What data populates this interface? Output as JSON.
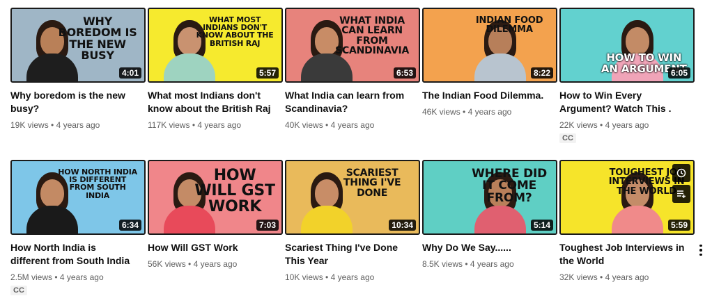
{
  "videos": [
    {
      "title": "Why boredom is the new busy?",
      "views": "19K views",
      "age": "4 years ago",
      "duration": "4:01",
      "thumb_text": "WHY BOREDOM IS THE NEW BUSY",
      "bg": "#9fb6c6",
      "cc": ""
    },
    {
      "title": "What most Indians don't know about the British Raj",
      "views": "117K views",
      "age": "4 years ago",
      "duration": "5:57",
      "thumb_text": "WHAT MOST INDIANS DON'T KNOW ABOUT THE BRITISH RAJ",
      "bg": "#f6ea2e",
      "cc": ""
    },
    {
      "title": "What India can learn from Scandinavia?",
      "views": "40K views",
      "age": "4 years ago",
      "duration": "6:53",
      "thumb_text": "WHAT INDIA CAN LEARN FROM SCANDINAVIA",
      "bg": "#e7837c",
      "cc": ""
    },
    {
      "title": "The Indian Food Dilemma.",
      "views": "46K views",
      "age": "4 years ago",
      "duration": "8:22",
      "thumb_text": "INDIAN FOOD DILEMMA",
      "bg": "#f3a24e",
      "cc": ""
    },
    {
      "title": "How to Win Every Argument? Watch This .",
      "views": "22K views",
      "age": "4 years ago",
      "duration": "6:05",
      "thumb_text": "HOW TO WIN AN ARGUMENT",
      "bg": "#62d1cf",
      "cc": "CC"
    },
    {
      "title": "How North India is different from South India",
      "views": "2.5M views",
      "age": "4 years ago",
      "duration": "6:34",
      "thumb_text": "HOW NORTH INDIA IS DIFFERENT FROM SOUTH INDIA",
      "bg": "#7ec6e8",
      "cc": "CC"
    },
    {
      "title": "How Will GST Work",
      "views": "56K views",
      "age": "4 years ago",
      "duration": "7:03",
      "thumb_text": "HOW WILL GST WORK",
      "bg": "#f0868a",
      "cc": ""
    },
    {
      "title": "Scariest Thing I've Done This Year",
      "views": "10K views",
      "age": "4 years ago",
      "duration": "10:34",
      "thumb_text": "SCARIEST THING I'VE DONE",
      "bg": "#e9ba5b",
      "cc": ""
    },
    {
      "title": "Why Do We Say......",
      "views": "8.5K views",
      "age": "4 years ago",
      "duration": "5:14",
      "thumb_text": "WHERE DID IT COME FROM?",
      "bg": "#5fcfc4",
      "cc": ""
    },
    {
      "title": "Toughest Job Interviews in the World",
      "views": "32K views",
      "age": "4 years ago",
      "duration": "5:59",
      "thumb_text": "TOUGHEST JOB INTERVIEWS IN THE WORLD",
      "bg": "#f6e42a",
      "cc": ""
    }
  ],
  "separator": "•",
  "icons": {
    "watch_later": "clock-icon",
    "add_to_queue": "queue-icon",
    "more": "more-vert-icon"
  }
}
